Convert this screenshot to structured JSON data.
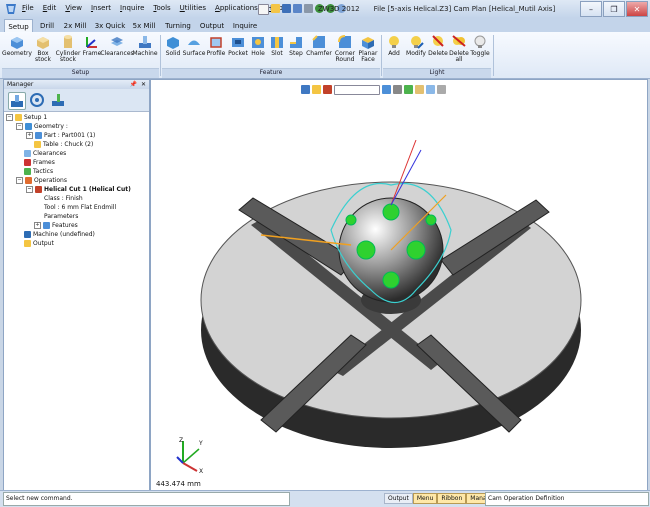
{
  "menu": [
    "File",
    "Edit",
    "View",
    "Insert",
    "Inquire",
    "Tools",
    "Utilities",
    "Applications",
    "Help"
  ],
  "window": {
    "app": "ZW3D 2012",
    "document": "File [5-axis Helical.Z3]  Cam Plan [Helical_Mutil Axis]"
  },
  "tabs": [
    "Setup",
    "Drill",
    "2x Mill",
    "3x Quick",
    "5x Mill",
    "Turning",
    "Output",
    "Inquire"
  ],
  "ribbon": {
    "setup": [
      "Geometry",
      "Box stock",
      "Cylinder stock",
      "Frame",
      "Clearances",
      "Machine"
    ],
    "setup_label": "Setup",
    "feature": [
      "Solid",
      "Surface",
      "Profile",
      "Pocket",
      "Hole",
      "Slot",
      "Step",
      "Chamfer",
      "Corner Round",
      "Planar Face"
    ],
    "feature_label": "Feature",
    "light": [
      "Add",
      "Modify",
      "Delete",
      "Delete all",
      "Toggle"
    ],
    "light_label": "Light"
  },
  "manager": {
    "title": "Manager",
    "tree": [
      "Setup 1",
      "Geometry :",
      "Part : Part001 (1)",
      "Table : Chuck (2)",
      "Clearances",
      "Frames",
      "Tactics",
      "Operations",
      "Helical Cut 1 (Helical Cut)",
      "Class : Finish",
      "Tool : 6 mm Flat Endmill",
      "Parameters",
      "Features",
      "Machine (undefined)",
      "Output"
    ]
  },
  "viewport": {
    "scale": "443.474 mm",
    "axes": [
      "X",
      "Y",
      "Z"
    ]
  },
  "status": {
    "message": "Select new command.",
    "buttons": [
      "Output",
      "Menu",
      "Ribbon",
      "Manager"
    ],
    "right": "Cam Operation Definition"
  }
}
